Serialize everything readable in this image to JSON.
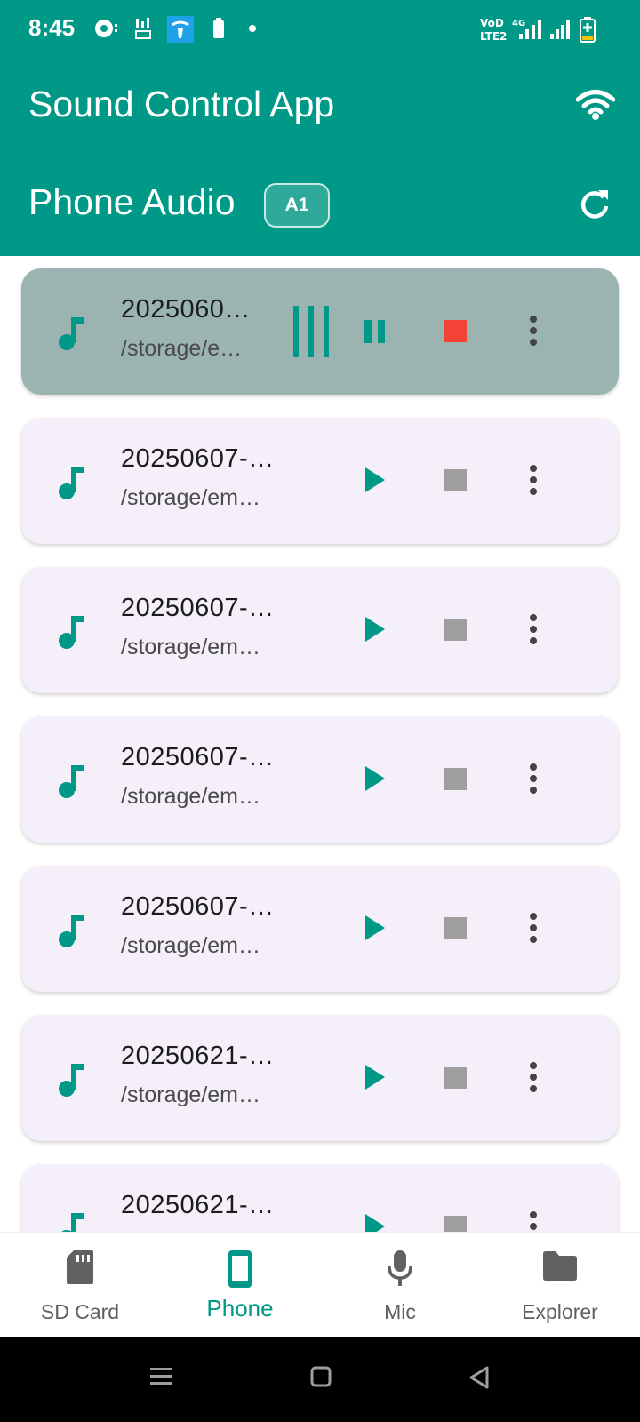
{
  "status_bar": {
    "time": "8:45",
    "icons": [
      "sync-icon",
      "signal-badge-icon",
      "telenor-icon",
      "battery-small-icon",
      "dot-icon",
      "volte-icon",
      "4g-signal-icon",
      "signal-icon",
      "battery-charging-icon"
    ]
  },
  "header": {
    "app_title": "Sound Control App",
    "connection_icon": "wifi-icon",
    "section_title": "Phone Audio",
    "badge": "A1",
    "refresh_icon": "refresh-icon"
  },
  "colors": {
    "primary": "#009886",
    "card_bg": "#f4eff8",
    "active_card_bg": "#9bb4b2",
    "stop_active": "#f44336",
    "stop_inactive": "#9e9e9e"
  },
  "recordings": [
    {
      "title": "2025060…",
      "path": "/storage/e…",
      "state": "playing"
    },
    {
      "title": "20250607-…",
      "path": "/storage/em…",
      "state": "idle"
    },
    {
      "title": "20250607-…",
      "path": "/storage/em…",
      "state": "idle"
    },
    {
      "title": "20250607-…",
      "path": "/storage/em…",
      "state": "idle"
    },
    {
      "title": "20250607-…",
      "path": "/storage/em…",
      "state": "idle"
    },
    {
      "title": "20250621-…",
      "path": "/storage/em…",
      "state": "idle"
    },
    {
      "title": "20250621-…",
      "path": "",
      "state": "idle"
    }
  ],
  "bottom_nav": {
    "items": [
      {
        "label": "SD Card",
        "icon": "sd-card-icon"
      },
      {
        "label": "Phone",
        "icon": "phone-icon",
        "selected": true
      },
      {
        "label": "Mic",
        "icon": "mic-icon"
      },
      {
        "label": "Explorer",
        "icon": "folder-icon"
      }
    ]
  }
}
